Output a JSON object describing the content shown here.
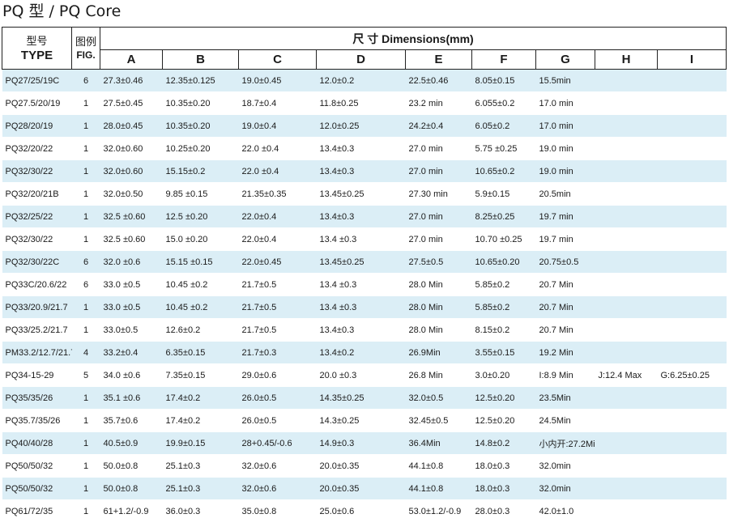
{
  "title": "PQ 型  / PQ Core",
  "headers": {
    "type_cn": "型号",
    "type_en": "TYPE",
    "fig_cn": "图例",
    "fig_en": "FIG.",
    "dimensions": "尺 寸 Dimensions(mm)",
    "columns": [
      "A",
      "B",
      "C",
      "D",
      "E",
      "F",
      "G",
      "H",
      "I"
    ]
  },
  "rows": [
    [
      "PQ27/25/19C",
      "6",
      "27.3±0.46",
      "12.35±0.125",
      "19.0±0.45",
      "12.0±0.2",
      "22.5±0.46",
      "8.05±0.15",
      "15.5min",
      "",
      ""
    ],
    [
      "PQ27.5/20/19",
      "1",
      "27.5±0.45",
      "10.35±0.20",
      "18.7±0.4",
      "11.8±0.25",
      "23.2 min",
      "6.055±0.2",
      "17.0  min",
      "",
      ""
    ],
    [
      "PQ28/20/19",
      "1",
      "28.0±0.45",
      "10.35±0.20",
      "19.0±0.4",
      "12.0±0.25",
      "24.2±0.4",
      "6.05±0.2",
      "17.0  min",
      "",
      ""
    ],
    [
      "PQ32/20/22",
      "1",
      "32.0±0.60",
      "10.25±0.20",
      "22.0 ±0.4",
      "13.4±0.3",
      "27.0  min",
      "5.75  ±0.25",
      "19.0 min",
      "",
      ""
    ],
    [
      "PQ32/30/22",
      "1",
      "32.0±0.60",
      "15.15±0.2",
      "22.0 ±0.4",
      "13.4±0.3",
      "27.0  min",
      "10.65±0.2",
      "19.0 min",
      "",
      ""
    ],
    [
      "PQ32/20/21B",
      "1",
      "32.0±0.50",
      "9.85 ±0.15",
      "21.35±0.35",
      "13.45±0.25",
      "27.30 min",
      "5.9±0.15",
      "20.5min",
      "",
      ""
    ],
    [
      "PQ32/25/22",
      "1",
      "32.5 ±0.60",
      "12.5 ±0.20",
      "22.0±0.4",
      "13.4±0.3",
      "27.0 min",
      "8.25±0.25",
      "19.7 min",
      "",
      ""
    ],
    [
      "PQ32/30/22",
      "1",
      "32.5 ±0.60",
      "15.0 ±0.20",
      "22.0±0.4",
      "13.4 ±0.3",
      "27.0  min",
      "10.70 ±0.25",
      "19.7 min",
      "",
      ""
    ],
    [
      "PQ32/30/22C",
      "6",
      "32.0 ±0.6",
      "15.15 ±0.15",
      "22.0±0.45",
      "13.45±0.25",
      "27.5±0.5",
      "10.65±0.20",
      "20.75±0.5",
      "",
      ""
    ],
    [
      "PQ33C/20.6/22",
      "6",
      "33.0 ±0.5",
      "10.45 ±0.2",
      "21.7±0.5",
      "13.4 ±0.3",
      "28.0 Min",
      "5.85±0.2",
      "20.7 Min",
      "",
      ""
    ],
    [
      "PQ33/20.9/21.7",
      "1",
      "33.0 ±0.5",
      "10.45 ±0.2",
      "21.7±0.5",
      "13.4 ±0.3",
      "28.0 Min",
      "5.85±0.2",
      "20.7 Min",
      "",
      ""
    ],
    [
      "PQ33/25.2/21.7",
      "1",
      "33.0±0.5",
      "12.6±0.2",
      "21.7±0.5",
      "13.4±0.3",
      "28.0 Min",
      "8.15±0.2",
      "20.7 Min",
      "",
      ""
    ],
    [
      "PM33.2/12.7/21.7",
      "4",
      "33.2±0.4",
      "6.35±0.15",
      "21.7±0.3",
      "13.4±0.2",
      "26.9Min",
      "3.55±0.15",
      "19.2 Min",
      "",
      ""
    ],
    [
      "PQ34-15-29",
      "5",
      "34.0  ±0.6",
      "7.35±0.15",
      "29.0±0.6",
      "20.0 ±0.3",
      "26.8 Min",
      "3.0±0.20",
      "I:8.9 Min",
      "J:12.4 Max",
      "G:6.25±0.25"
    ],
    [
      "PQ35/35/26",
      "1",
      "35.1 ±0.6",
      "17.4±0.2",
      "26.0±0.5",
      "14.35±0.25",
      "32.0±0.5",
      "12.5±0.20",
      "23.5Min",
      "",
      ""
    ],
    [
      "PQ35.7/35/26",
      "1",
      "35.7±0.6",
      "17.4±0.2",
      "26.0±0.5",
      "14.3±0.25",
      "32.45±0.5",
      "12.5±0.20",
      "24.5Min",
      "",
      ""
    ],
    [
      "PQ40/40/28",
      "1",
      "40.5±0.9",
      "19.9±0.15",
      "28+0.45/-0.6",
      "14.9±0.3",
      "36.4Min",
      "14.8±0.2",
      "小内开:27.2Min",
      "",
      ""
    ],
    [
      "PQ50/50/32",
      "1",
      "50.0±0.8",
      "25.1±0.3",
      "32.0±0.6",
      "20.0±0.35",
      "44.1±0.8",
      "18.0±0.3",
      "32.0min",
      "",
      ""
    ],
    [
      "PQ50/50/32",
      "1",
      "50.0±0.8",
      "25.1±0.3",
      "32.0±0.6",
      "20.0±0.35",
      "44.1±0.8",
      "18.0±0.3",
      "32.0min",
      "",
      ""
    ],
    [
      "PQ61/72/35",
      "1",
      "61+1.2/-0.9",
      "36.0±0.3",
      "35.0±0.8",
      "25.0±0.6",
      "53.0±1.2/-0.9",
      "28.0±0.3",
      "42.0±1.0",
      "",
      ""
    ]
  ]
}
